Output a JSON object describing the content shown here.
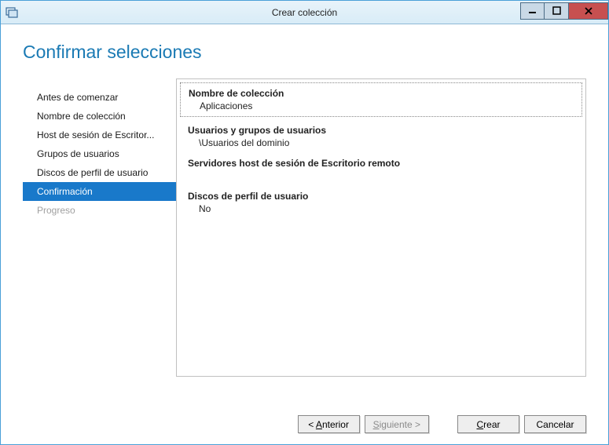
{
  "window": {
    "title": "Crear colección"
  },
  "page": {
    "heading": "Confirmar selecciones"
  },
  "sidebar": {
    "items": [
      {
        "label": "Antes de comenzar",
        "state": "normal"
      },
      {
        "label": "Nombre de colección",
        "state": "normal"
      },
      {
        "label": "Host de sesión de Escritor...",
        "state": "normal"
      },
      {
        "label": "Grupos de usuarios",
        "state": "normal"
      },
      {
        "label": "Discos de perfil de usuario",
        "state": "normal"
      },
      {
        "label": "Confirmación",
        "state": "selected"
      },
      {
        "label": "Progreso",
        "state": "disabled"
      }
    ]
  },
  "summary": {
    "collection_name": {
      "label": "Nombre de colección",
      "value": "Aplicaciones"
    },
    "users_groups": {
      "label": "Usuarios y grupos de usuarios",
      "value": "\\Usuarios del dominio"
    },
    "session_hosts": {
      "label": "Servidores host de sesión de Escritorio remoto",
      "value": " "
    },
    "profile_disks": {
      "label": "Discos de perfil de usuario",
      "value": "No"
    }
  },
  "buttons": {
    "previous_pre": "< ",
    "previous_ul": "A",
    "previous_post": "nterior",
    "next_ul": "S",
    "next_post": "iguiente >",
    "create_ul": "C",
    "create_post": "rear",
    "cancel": "Cancelar"
  }
}
